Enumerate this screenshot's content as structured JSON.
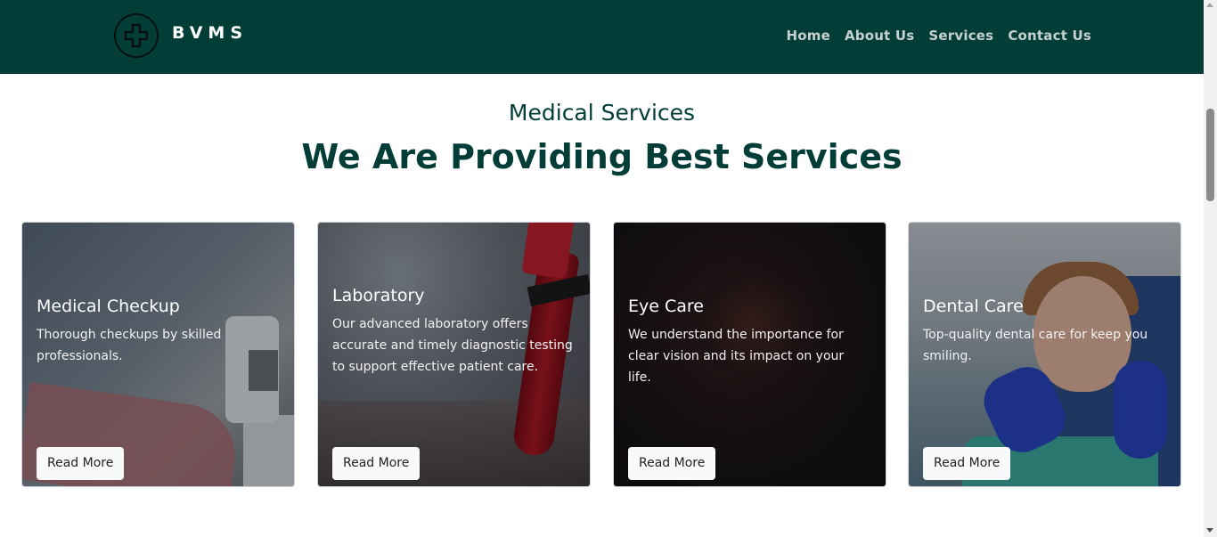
{
  "nav": {
    "brand": "BVMS",
    "links": [
      "Home",
      "About Us",
      "Services",
      "Contact Us"
    ]
  },
  "header": {
    "subtitle": "Medical Services",
    "title": "We Are Providing Best Services"
  },
  "cards": [
    {
      "title": "Medical Checkup",
      "description": "Thorough checkups by skilled professionals.",
      "button": "Read More"
    },
    {
      "title": "Laboratory",
      "description": "Our advanced laboratory offers accurate and timely diagnostic testing to support effective patient care.",
      "button": "Read More"
    },
    {
      "title": "Eye Care",
      "description": "We understand the importance for clear vision and its impact on your life.",
      "button": "Read More"
    },
    {
      "title": "Dental Care",
      "description": "Top-quality dental care for keep you smiling.",
      "button": "Read More"
    }
  ],
  "colors": {
    "brand": "#033d37",
    "nav_link": "#c6d0cf"
  }
}
